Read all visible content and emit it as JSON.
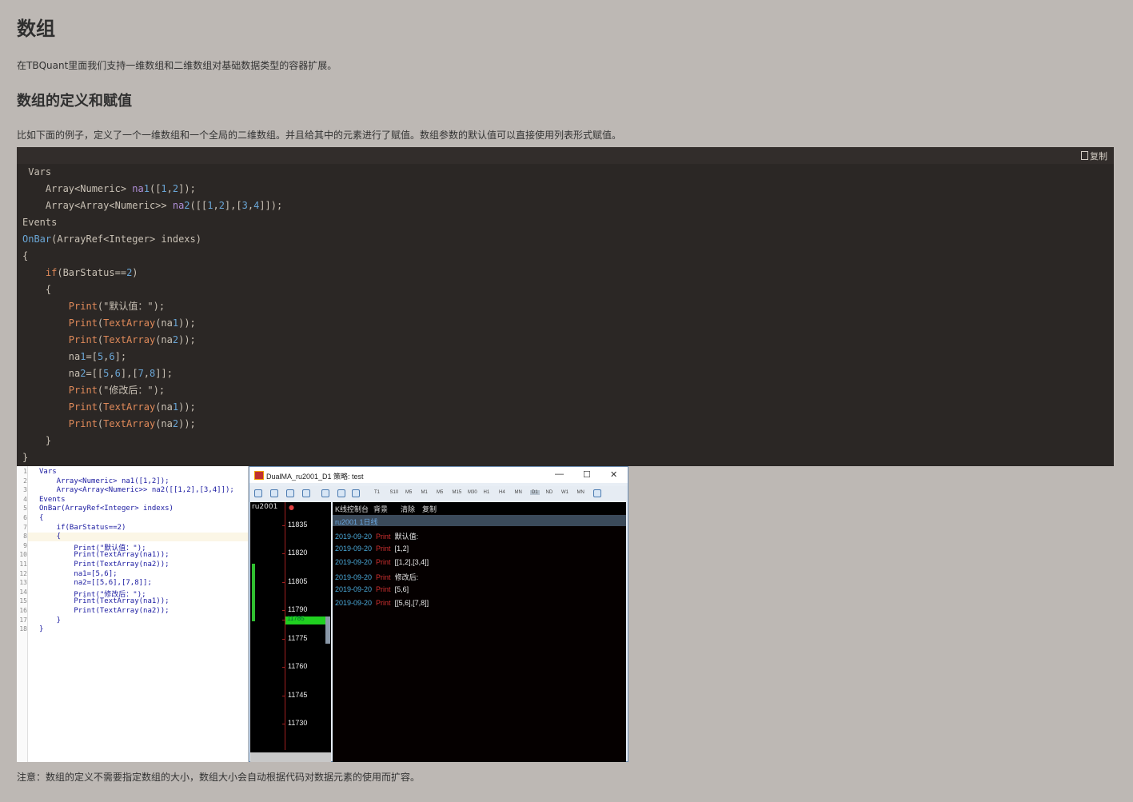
{
  "page": {
    "title": "数组",
    "intro": "在TBQuant里面我们支持一维数组和二维数组对基础数据类型的容器扩展。",
    "section_title": "数组的定义和赋值",
    "section_text": "比如下面的例子，定义了一个一维数组和一个全局的二维数组。并且给其中的元素进行了赋值。数组参数的默认值可以直接使用列表形式赋值。",
    "note": "注意：数组的定义不需要指定数组的大小，数组大小会自动根据代码对数据元素的使用而扩容。"
  },
  "codeblock": {
    "copy_label": "复制",
    "lines": [
      " Vars",
      "    Array<Numeric> na1([1,2]);",
      "    Array<Array<Numeric>> na2([[1,2],[3,4]]);",
      "Events",
      "OnBar(ArrayRef<Integer> indexs)",
      "{",
      "    if(BarStatus==2)",
      "    {",
      "        Print(\"默认值：\");",
      "        Print(TextArray(na1));",
      "        Print(TextArray(na2));",
      "        na1=[5,6];",
      "        na2=[[5,6],[7,8]];",
      "        Print(\"修改后：\");",
      "        Print(TextArray(na1));",
      "        Print(TextArray(na2));",
      "    }",
      "}"
    ]
  },
  "editor": {
    "line_numbers": [
      "1",
      "2",
      "3",
      "4",
      "5",
      "6",
      "7",
      "8",
      "9",
      "10",
      "11",
      "12",
      "13",
      "14",
      "15",
      "16",
      "17",
      "18"
    ],
    "lines": [
      "Vars",
      "    Array<Numeric> na1([1,2]);",
      "    Array<Array<Numeric>> na2([[1,2],[3,4]]);",
      "Events",
      "OnBar(ArrayRef<Integer> indexs)",
      "{",
      "    if(BarStatus==2)",
      "    {",
      "        Print(\"默认值：\");",
      "        Print(TextArray(na1));",
      "        Print(TextArray(na2));",
      "        na1=[5,6];",
      "        na2=[[5,6],[7,8]];",
      "        Print(\"修改后：\");",
      "        Print(TextArray(na1));",
      "        Print(TextArray(na2));",
      "    }",
      "}"
    ]
  },
  "tb_window": {
    "title": "DualMA_ru2001_D1  策略: test",
    "minimize": "—",
    "maximize": "☐",
    "close": "✕",
    "timeframes": [
      "T1",
      "S10",
      "M5",
      "M1",
      "M5",
      "M15",
      "M30",
      "H1",
      "H4",
      "MN",
      "D1",
      "ND",
      "W1",
      "MN"
    ],
    "chart_symbol": "ru2001",
    "prices": [
      "11835",
      "11820",
      "11805",
      "11790",
      "11785",
      "11775",
      "11760",
      "11745",
      "11730"
    ],
    "console_tabs": [
      "K线控制台",
      "背景",
      "清除",
      "复制"
    ],
    "selected_row": "ru2001 1日线",
    "rows": [
      {
        "date": "2019-09-20",
        "kind": "Print",
        "text": "默认值:"
      },
      {
        "date": "2019-09-20",
        "kind": "Print",
        "text": "[1,2]"
      },
      {
        "date": "2019-09-20",
        "kind": "Print",
        "text": "[[1,2],[3,4]]"
      },
      {
        "date": "2019-09-20",
        "kind": "Print",
        "text": "修改后:"
      },
      {
        "date": "2019-09-20",
        "kind": "Print",
        "text": "[5,6]"
      },
      {
        "date": "2019-09-20",
        "kind": "Print",
        "text": "[[5,6],[7,8]]"
      }
    ]
  }
}
